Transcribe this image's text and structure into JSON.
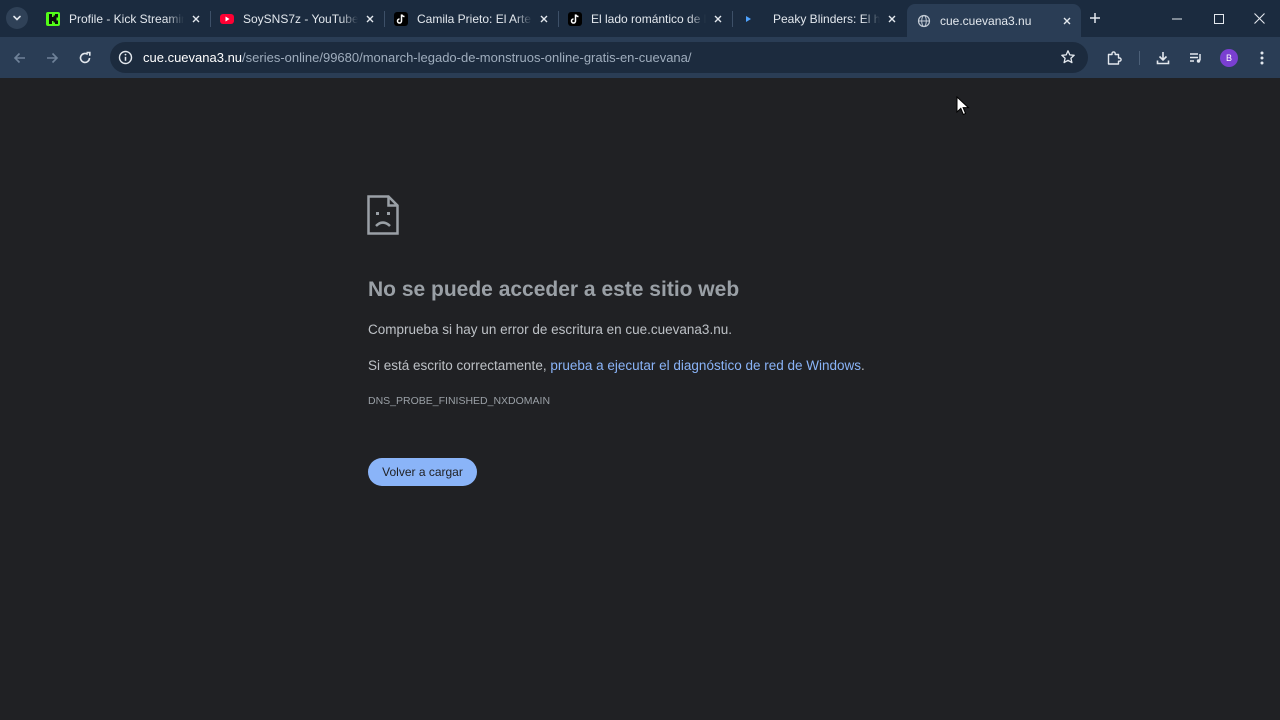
{
  "tabs": [
    {
      "title": "Profile - Kick Streaming",
      "favicon": "kick-favicon",
      "active": false
    },
    {
      "title": "SoySNS7z - YouTube",
      "favicon": "youtube-favicon",
      "active": false
    },
    {
      "title": "Camila Prieto: El Arte de",
      "favicon": "tiktok-favicon",
      "active": false
    },
    {
      "title": "El lado romántico de la",
      "favicon": "tiktok-favicon",
      "active": false
    },
    {
      "title": "Peaky Blinders: El hombre",
      "favicon": "play-favicon",
      "active": false
    },
    {
      "title": "cue.cuevana3.nu",
      "favicon": "globe-favicon",
      "active": true
    }
  ],
  "toolbar": {
    "url_host": "cue.cuevana3.nu",
    "url_path": "/series-online/99680/monarch-legado-de-monstruos-online-gratis-en-cuevana/",
    "profile_initial": "B"
  },
  "error_page": {
    "heading": "No se puede acceder a este sitio web",
    "line1": "Comprueba si hay un error de escritura en cue.cuevana3.nu.",
    "line2_prefix": "Si está escrito correctamente, ",
    "line2_link": "prueba a ejecutar el diagnóstico de red de Windows",
    "line2_suffix": ".",
    "error_code": "DNS_PROBE_FINISHED_NXDOMAIN",
    "reload_label": "Volver a cargar"
  },
  "colors": {
    "tabstrip_bg": "#1b2b3f",
    "toolbar_bg": "#2a3d55",
    "page_bg": "#202124",
    "link": "#8ab4f8",
    "kick_green": "#53fc18",
    "youtube_red": "#ff0033"
  }
}
